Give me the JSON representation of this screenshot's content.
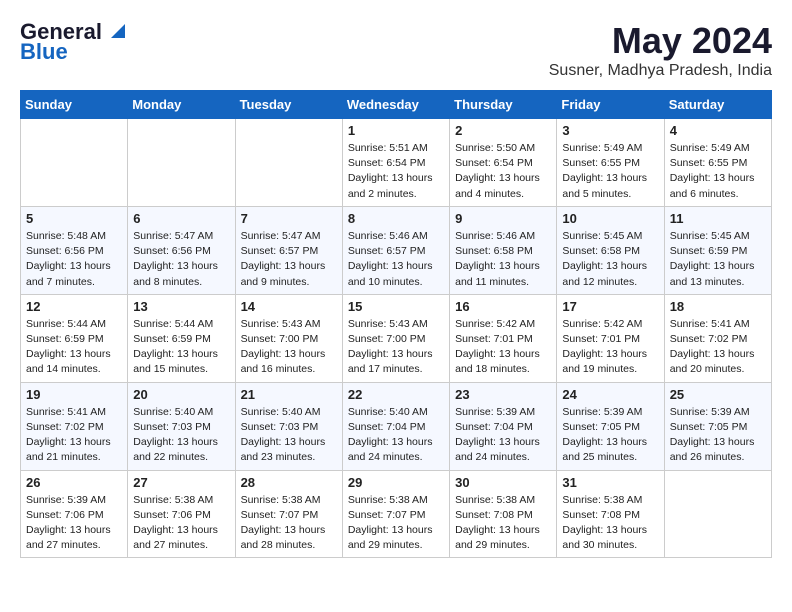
{
  "logo": {
    "line1": "General",
    "line2": "Blue"
  },
  "title": "May 2024",
  "location": "Susner, Madhya Pradesh, India",
  "days_of_week": [
    "Sunday",
    "Monday",
    "Tuesday",
    "Wednesday",
    "Thursday",
    "Friday",
    "Saturday"
  ],
  "weeks": [
    [
      {
        "day": "",
        "info": ""
      },
      {
        "day": "",
        "info": ""
      },
      {
        "day": "",
        "info": ""
      },
      {
        "day": "1",
        "info": "Sunrise: 5:51 AM\nSunset: 6:54 PM\nDaylight: 13 hours and 2 minutes."
      },
      {
        "day": "2",
        "info": "Sunrise: 5:50 AM\nSunset: 6:54 PM\nDaylight: 13 hours and 4 minutes."
      },
      {
        "day": "3",
        "info": "Sunrise: 5:49 AM\nSunset: 6:55 PM\nDaylight: 13 hours and 5 minutes."
      },
      {
        "day": "4",
        "info": "Sunrise: 5:49 AM\nSunset: 6:55 PM\nDaylight: 13 hours and 6 minutes."
      }
    ],
    [
      {
        "day": "5",
        "info": "Sunrise: 5:48 AM\nSunset: 6:56 PM\nDaylight: 13 hours and 7 minutes."
      },
      {
        "day": "6",
        "info": "Sunrise: 5:47 AM\nSunset: 6:56 PM\nDaylight: 13 hours and 8 minutes."
      },
      {
        "day": "7",
        "info": "Sunrise: 5:47 AM\nSunset: 6:57 PM\nDaylight: 13 hours and 9 minutes."
      },
      {
        "day": "8",
        "info": "Sunrise: 5:46 AM\nSunset: 6:57 PM\nDaylight: 13 hours and 10 minutes."
      },
      {
        "day": "9",
        "info": "Sunrise: 5:46 AM\nSunset: 6:58 PM\nDaylight: 13 hours and 11 minutes."
      },
      {
        "day": "10",
        "info": "Sunrise: 5:45 AM\nSunset: 6:58 PM\nDaylight: 13 hours and 12 minutes."
      },
      {
        "day": "11",
        "info": "Sunrise: 5:45 AM\nSunset: 6:59 PM\nDaylight: 13 hours and 13 minutes."
      }
    ],
    [
      {
        "day": "12",
        "info": "Sunrise: 5:44 AM\nSunset: 6:59 PM\nDaylight: 13 hours and 14 minutes."
      },
      {
        "day": "13",
        "info": "Sunrise: 5:44 AM\nSunset: 6:59 PM\nDaylight: 13 hours and 15 minutes."
      },
      {
        "day": "14",
        "info": "Sunrise: 5:43 AM\nSunset: 7:00 PM\nDaylight: 13 hours and 16 minutes."
      },
      {
        "day": "15",
        "info": "Sunrise: 5:43 AM\nSunset: 7:00 PM\nDaylight: 13 hours and 17 minutes."
      },
      {
        "day": "16",
        "info": "Sunrise: 5:42 AM\nSunset: 7:01 PM\nDaylight: 13 hours and 18 minutes."
      },
      {
        "day": "17",
        "info": "Sunrise: 5:42 AM\nSunset: 7:01 PM\nDaylight: 13 hours and 19 minutes."
      },
      {
        "day": "18",
        "info": "Sunrise: 5:41 AM\nSunset: 7:02 PM\nDaylight: 13 hours and 20 minutes."
      }
    ],
    [
      {
        "day": "19",
        "info": "Sunrise: 5:41 AM\nSunset: 7:02 PM\nDaylight: 13 hours and 21 minutes."
      },
      {
        "day": "20",
        "info": "Sunrise: 5:40 AM\nSunset: 7:03 PM\nDaylight: 13 hours and 22 minutes."
      },
      {
        "day": "21",
        "info": "Sunrise: 5:40 AM\nSunset: 7:03 PM\nDaylight: 13 hours and 23 minutes."
      },
      {
        "day": "22",
        "info": "Sunrise: 5:40 AM\nSunset: 7:04 PM\nDaylight: 13 hours and 24 minutes."
      },
      {
        "day": "23",
        "info": "Sunrise: 5:39 AM\nSunset: 7:04 PM\nDaylight: 13 hours and 24 minutes."
      },
      {
        "day": "24",
        "info": "Sunrise: 5:39 AM\nSunset: 7:05 PM\nDaylight: 13 hours and 25 minutes."
      },
      {
        "day": "25",
        "info": "Sunrise: 5:39 AM\nSunset: 7:05 PM\nDaylight: 13 hours and 26 minutes."
      }
    ],
    [
      {
        "day": "26",
        "info": "Sunrise: 5:39 AM\nSunset: 7:06 PM\nDaylight: 13 hours and 27 minutes."
      },
      {
        "day": "27",
        "info": "Sunrise: 5:38 AM\nSunset: 7:06 PM\nDaylight: 13 hours and 27 minutes."
      },
      {
        "day": "28",
        "info": "Sunrise: 5:38 AM\nSunset: 7:07 PM\nDaylight: 13 hours and 28 minutes."
      },
      {
        "day": "29",
        "info": "Sunrise: 5:38 AM\nSunset: 7:07 PM\nDaylight: 13 hours and 29 minutes."
      },
      {
        "day": "30",
        "info": "Sunrise: 5:38 AM\nSunset: 7:08 PM\nDaylight: 13 hours and 29 minutes."
      },
      {
        "day": "31",
        "info": "Sunrise: 5:38 AM\nSunset: 7:08 PM\nDaylight: 13 hours and 30 minutes."
      },
      {
        "day": "",
        "info": ""
      }
    ]
  ]
}
